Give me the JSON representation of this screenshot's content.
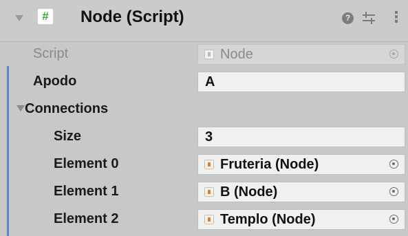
{
  "header": {
    "title": "Node (Script)",
    "script_icon_glyph": "#",
    "help_glyph": "?",
    "more_glyph": "⋮",
    "icons": [
      "foldout-arrow-icon",
      "script-icon",
      "help-icon",
      "presets-icon",
      "more-icon"
    ]
  },
  "script_field": {
    "label": "Script",
    "value": "Node"
  },
  "apodo_field": {
    "label": "Apodo",
    "value": "A"
  },
  "connections": {
    "label": "Connections",
    "size_label": "Size",
    "size_value": "3",
    "elements": [
      {
        "label": "Element 0",
        "value": "Fruteria (Node)"
      },
      {
        "label": "Element 1",
        "value": "B (Node)"
      },
      {
        "label": "Element 2",
        "value": "Templo (Node)"
      }
    ]
  },
  "colors": {
    "panel_bg": "#c8c8c8",
    "field_bg": "#f0f0f0",
    "script_icon_green": "#3ca53c",
    "accent_strip": "#5a87c6"
  }
}
